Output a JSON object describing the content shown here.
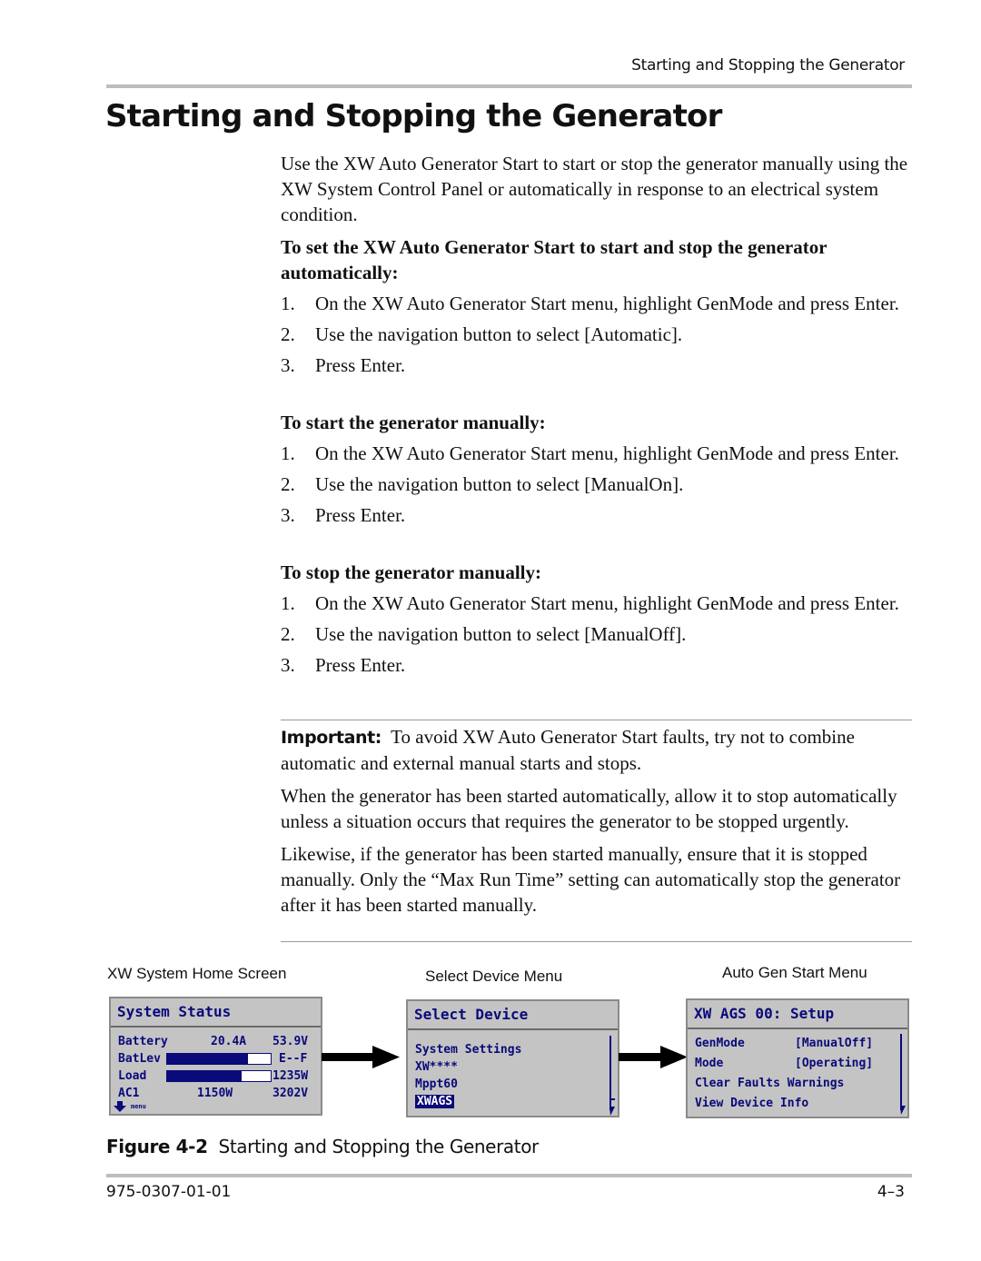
{
  "header": {
    "running_title": "Starting and Stopping the Generator"
  },
  "title": "Starting and Stopping the Generator",
  "intro": "Use the XW Auto Generator Start to start or stop the generator manually using the XW System Control Panel or automatically in response to an electrical system condition.",
  "procedures": [
    {
      "heading": "To set the XW Auto Generator Start to start and stop the generator automatically:",
      "steps": [
        {
          "num": "1.",
          "text": "On the XW Auto Generator Start menu, highlight GenMode and press Enter."
        },
        {
          "num": "2.",
          "text": "Use the navigation button to select [Automatic]."
        },
        {
          "num": "3.",
          "text": "Press Enter."
        }
      ]
    },
    {
      "heading": "To start the generator manually:",
      "steps": [
        {
          "num": "1.",
          "text": "On the XW Auto Generator Start menu, highlight GenMode and press Enter."
        },
        {
          "num": "2.",
          "text": "Use the navigation button to select [ManualOn]."
        },
        {
          "num": "3.",
          "text": "Press Enter."
        }
      ]
    },
    {
      "heading": "To stop the generator manually:",
      "steps": [
        {
          "num": "1.",
          "text": "On the XW Auto Generator Start menu, highlight GenMode and press Enter."
        },
        {
          "num": "2.",
          "text": "Use the navigation button to select [ManualOff]."
        },
        {
          "num": "3.",
          "text": "Press Enter."
        }
      ]
    }
  ],
  "important": {
    "label": "Important:",
    "text": "To avoid XW Auto Generator Start faults, try not to combine automatic and external manual starts and stops.",
    "para2": "When the generator has been started automatically, allow it to stop automatically unless a situation occurs that requires the generator to be stopped urgently.",
    "para3": "Likewise, if the generator has been started manually, ensure that it is stopped manually. Only the “Max Run Time” setting can automatically stop the generator after it has been started manually."
  },
  "figure": {
    "screens": [
      {
        "label": "XW System Home Screen",
        "title": "System Status",
        "rows": {
          "battery": {
            "name": "Battery",
            "current": "20.4A",
            "voltage": "53.9V"
          },
          "batlev": {
            "name": "BatLev",
            "level_fraction": 0.78,
            "scale": "E--F"
          },
          "load": {
            "name": "Load",
            "level_fraction": 0.72,
            "value": "1235W"
          },
          "ac1": {
            "name": "AC1",
            "power": "1150W",
            "voltage": "3202V"
          },
          "menu_hint": "menu"
        }
      },
      {
        "label": "Select Device Menu",
        "title": "Select Device",
        "items": [
          "System Settings",
          "XW****",
          "Mppt60",
          "XWAGS"
        ],
        "selected_index": 3
      },
      {
        "label": "Auto Gen Start Menu",
        "title": "XW AGS 00: Setup",
        "items": [
          {
            "name": "GenMode",
            "value": "[ManualOff]"
          },
          {
            "name": "Mode",
            "value": "[Operating]"
          },
          {
            "name": "Clear Faults Warnings",
            "value": ""
          },
          {
            "name": "View Device Info",
            "value": ""
          }
        ]
      }
    ],
    "caption_number": "Figure 4-2",
    "caption_text": "Starting and Stopping the Generator"
  },
  "footer": {
    "doc_number": "975-0307-01-01",
    "page_number": "4–3"
  },
  "colors": {
    "lcd_background": "#c4c4c4",
    "lcd_text": "#0a0a7a",
    "rule": "#bdbdbd"
  }
}
